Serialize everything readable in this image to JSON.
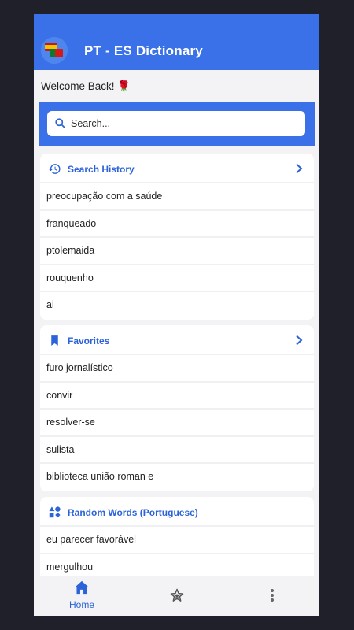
{
  "header": {
    "title": "PT - ES Dictionary",
    "logo_icon": "pt-es-flags-icon"
  },
  "welcome_text": "Welcome Back! 🌹",
  "search": {
    "placeholder": "Search...",
    "value": ""
  },
  "history": {
    "title": "Search History",
    "items": [
      "preocupação com a saúde",
      "franqueado",
      "ptolemaida",
      "rouquenho",
      "ai"
    ]
  },
  "favorites": {
    "title": "Favorites",
    "items": [
      "furo jornalístico",
      "convir",
      "resolver-se",
      "sulista",
      "biblioteca união roman e"
    ]
  },
  "random": {
    "title": "Random Words (Portuguese)",
    "items": [
      "eu parecer favorável",
      "mergulhou"
    ]
  },
  "nav": {
    "home_label": "Home"
  },
  "colors": {
    "primary": "#3a71e8",
    "accent_text": "#2c63d9",
    "background": "#f3f3f5"
  }
}
